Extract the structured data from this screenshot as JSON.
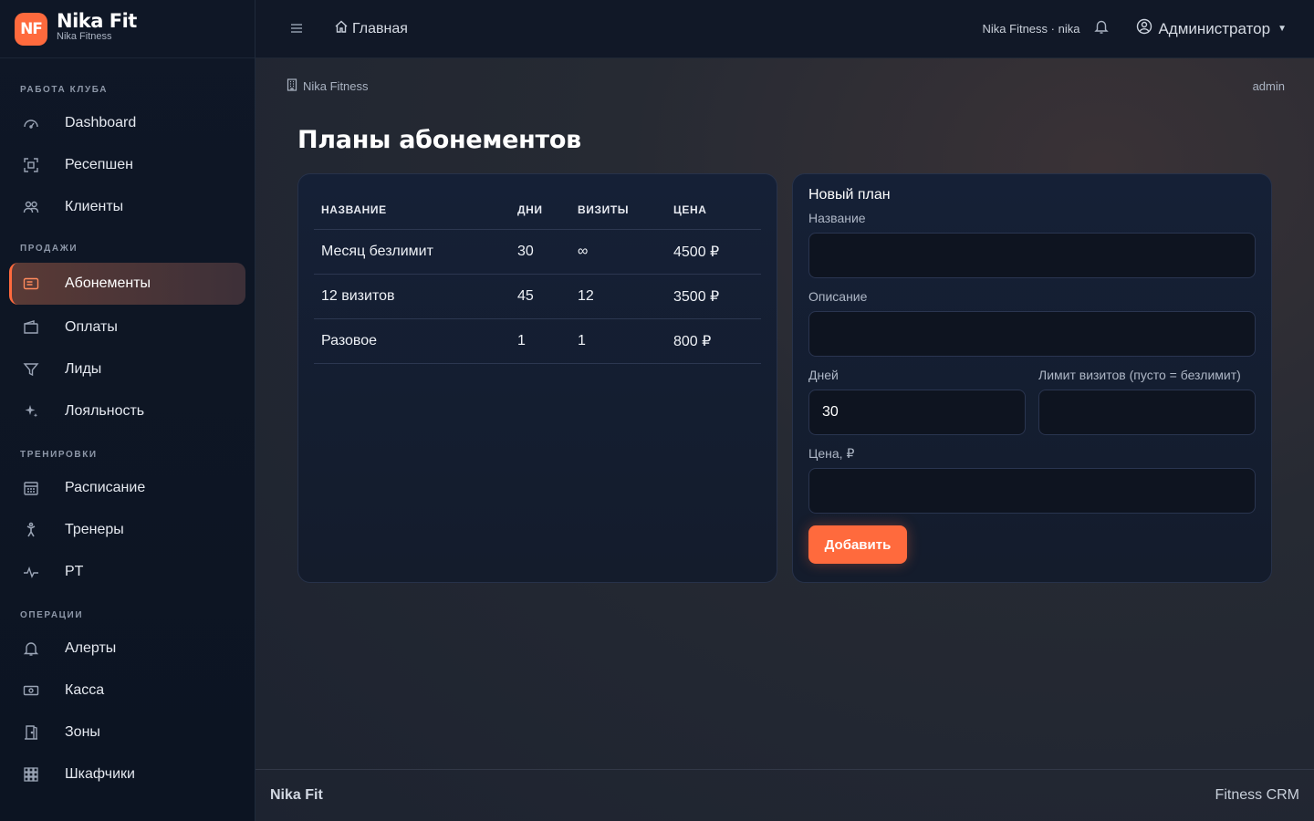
{
  "brand": {
    "logo": "NF",
    "title": "Nika Fit",
    "subtitle": "Nika Fitness"
  },
  "sidebar": {
    "sections": [
      {
        "title": "РАБОТА КЛУБА",
        "items": [
          {
            "label": "Dashboard",
            "icon": "gauge-icon"
          },
          {
            "label": "Ресепшен",
            "icon": "scan-icon"
          },
          {
            "label": "Клиенты",
            "icon": "people-icon"
          }
        ]
      },
      {
        "title": "ПРОДАЖИ",
        "items": [
          {
            "label": "Абонементы",
            "icon": "card-icon",
            "active": true
          },
          {
            "label": "Оплаты",
            "icon": "wallet-icon"
          },
          {
            "label": "Лиды",
            "icon": "funnel-icon"
          },
          {
            "label": "Лояльность",
            "icon": "sparkle-icon"
          }
        ]
      },
      {
        "title": "ТРЕНИРОВКИ",
        "items": [
          {
            "label": "Расписание",
            "icon": "calendar-icon"
          },
          {
            "label": "Тренеры",
            "icon": "person-arms-icon"
          },
          {
            "label": "PT",
            "icon": "pulse-icon"
          }
        ]
      },
      {
        "title": "ОПЕРАЦИИ",
        "items": [
          {
            "label": "Алерты",
            "icon": "bell-icon"
          },
          {
            "label": "Касса",
            "icon": "cash-icon"
          },
          {
            "label": "Зоны",
            "icon": "door-icon"
          },
          {
            "label": "Шкафчики",
            "icon": "grid-icon"
          }
        ]
      }
    ]
  },
  "topbar": {
    "home_label": "Главная",
    "org_label": "Nika Fitness · nika",
    "user_label": "Администратор"
  },
  "breadcrumb": {
    "org": "Nika Fitness",
    "user": "admin"
  },
  "page_title": "Планы абонементов",
  "plans_table": {
    "headers": [
      "НАЗВАНИЕ",
      "ДНИ",
      "ВИЗИТЫ",
      "ЦЕНА"
    ],
    "rows": [
      [
        "Месяц безлимит",
        "30",
        "∞",
        "4500 ₽"
      ],
      [
        "12 визитов",
        "45",
        "12",
        "3500 ₽"
      ],
      [
        "Разовое",
        "1",
        "1",
        "800 ₽"
      ]
    ]
  },
  "form": {
    "title": "Новый план",
    "name_label": "Название",
    "name_value": "",
    "desc_label": "Описание",
    "desc_value": "",
    "days_label": "Дней",
    "days_value": "30",
    "limit_label": "Лимит визитов (пусто = безлимит)",
    "limit_value": "",
    "price_label": "Цена, ₽",
    "price_value": "",
    "submit_label": "Добавить"
  },
  "footer": {
    "left": "Nika Fit",
    "right": "Fitness CRM"
  },
  "colors": {
    "accent": "#ff6a3d",
    "sidebar_bg": "#0f1726",
    "card_bg": "#152036"
  }
}
